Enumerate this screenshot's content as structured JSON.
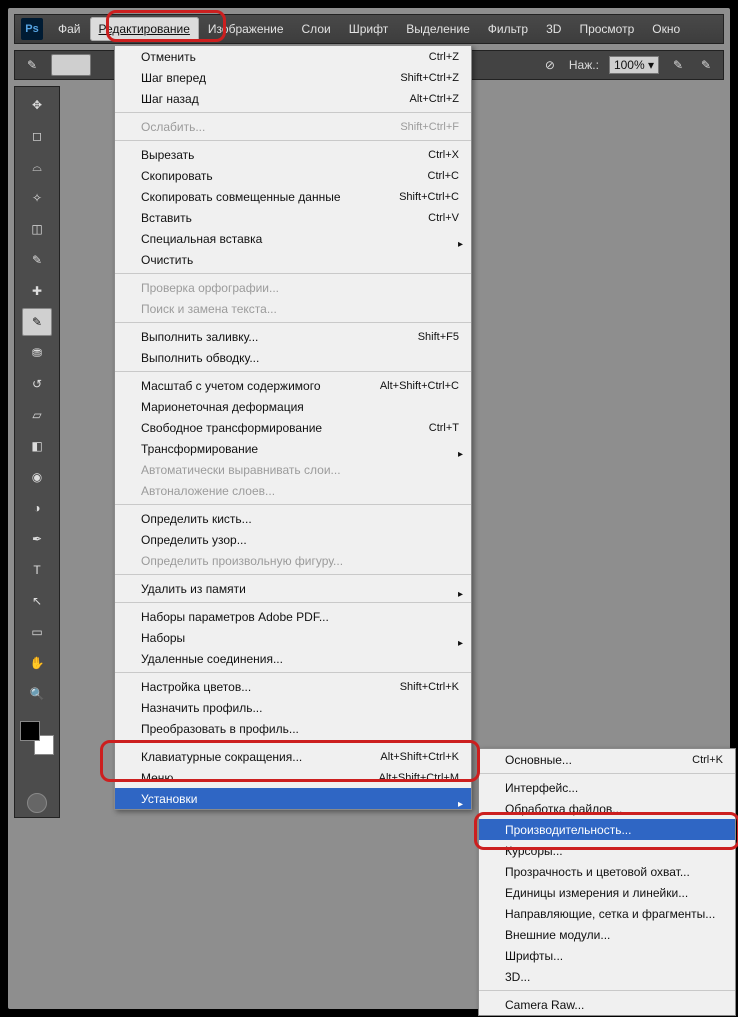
{
  "logo": "Ps",
  "menubar": [
    "Фай",
    "Редактирование",
    "Изображение",
    "Слои",
    "Шрифт",
    "Выделение",
    "Фильтр",
    "3D",
    "Просмотр",
    "Окно"
  ],
  "menubar_active_index": 1,
  "options": {
    "opacity_label": "Наж.:",
    "opacity_value": "100%"
  },
  "edit_menu": [
    {
      "t": "item",
      "label": "Отменить",
      "sc": "Ctrl+Z"
    },
    {
      "t": "item",
      "label": "Шаг вперед",
      "sc": "Shift+Ctrl+Z"
    },
    {
      "t": "item",
      "label": "Шаг назад",
      "sc": "Alt+Ctrl+Z"
    },
    {
      "t": "sep"
    },
    {
      "t": "item",
      "label": "Ослабить...",
      "sc": "Shift+Ctrl+F",
      "disabled": true
    },
    {
      "t": "sep"
    },
    {
      "t": "item",
      "label": "Вырезать",
      "sc": "Ctrl+X"
    },
    {
      "t": "item",
      "label": "Скопировать",
      "sc": "Ctrl+C"
    },
    {
      "t": "item",
      "label": "Скопировать совмещенные данные",
      "sc": "Shift+Ctrl+C"
    },
    {
      "t": "item",
      "label": "Вставить",
      "sc": "Ctrl+V"
    },
    {
      "t": "item",
      "label": "Специальная вставка",
      "sub": true
    },
    {
      "t": "item",
      "label": "Очистить"
    },
    {
      "t": "sep"
    },
    {
      "t": "item",
      "label": "Проверка орфографии...",
      "disabled": true
    },
    {
      "t": "item",
      "label": "Поиск и замена текста...",
      "disabled": true
    },
    {
      "t": "sep"
    },
    {
      "t": "item",
      "label": "Выполнить заливку...",
      "sc": "Shift+F5"
    },
    {
      "t": "item",
      "label": "Выполнить обводку..."
    },
    {
      "t": "sep"
    },
    {
      "t": "item",
      "label": "Масштаб с учетом содержимого",
      "sc": "Alt+Shift+Ctrl+C"
    },
    {
      "t": "item",
      "label": "Марионеточная деформация"
    },
    {
      "t": "item",
      "label": "Свободное трансформирование",
      "sc": "Ctrl+T"
    },
    {
      "t": "item",
      "label": "Трансформирование",
      "sub": true
    },
    {
      "t": "item",
      "label": "Автоматически выравнивать слои...",
      "disabled": true
    },
    {
      "t": "item",
      "label": "Автоналожение слоев...",
      "disabled": true
    },
    {
      "t": "sep"
    },
    {
      "t": "item",
      "label": "Определить кисть..."
    },
    {
      "t": "item",
      "label": "Определить узор..."
    },
    {
      "t": "item",
      "label": "Определить произвольную фигуру...",
      "disabled": true
    },
    {
      "t": "sep"
    },
    {
      "t": "item",
      "label": "Удалить из памяти",
      "sub": true
    },
    {
      "t": "sep"
    },
    {
      "t": "item",
      "label": "Наборы параметров Adobe PDF..."
    },
    {
      "t": "item",
      "label": "Наборы",
      "sub": true
    },
    {
      "t": "item",
      "label": "Удаленные соединения..."
    },
    {
      "t": "sep"
    },
    {
      "t": "item",
      "label": "Настройка цветов...",
      "sc": "Shift+Ctrl+K"
    },
    {
      "t": "item",
      "label": "Назначить профиль..."
    },
    {
      "t": "item",
      "label": "Преобразовать в профиль..."
    },
    {
      "t": "sep"
    },
    {
      "t": "item",
      "label": "Клавиатурные сокращения...",
      "sc": "Alt+Shift+Ctrl+K"
    },
    {
      "t": "item",
      "label": "Меню...",
      "sc": "Alt+Shift+Ctrl+M"
    },
    {
      "t": "item",
      "label": "Установки",
      "sub": true,
      "hl": true
    }
  ],
  "sub_menu": [
    {
      "t": "item",
      "label": "Основные...",
      "sc": "Ctrl+K"
    },
    {
      "t": "sep"
    },
    {
      "t": "item",
      "label": "Интерфейс..."
    },
    {
      "t": "item",
      "label": "Обработка файлов..."
    },
    {
      "t": "item",
      "label": "Производительность...",
      "hl": true
    },
    {
      "t": "item",
      "label": "Курсоры..."
    },
    {
      "t": "item",
      "label": "Прозрачность и цветовой охват..."
    },
    {
      "t": "item",
      "label": "Единицы измерения и линейки..."
    },
    {
      "t": "item",
      "label": "Направляющие, сетка и фрагменты..."
    },
    {
      "t": "item",
      "label": "Внешние модули..."
    },
    {
      "t": "item",
      "label": "Шрифты..."
    },
    {
      "t": "item",
      "label": "3D..."
    },
    {
      "t": "sep"
    },
    {
      "t": "item",
      "label": "Camera Raw..."
    }
  ]
}
